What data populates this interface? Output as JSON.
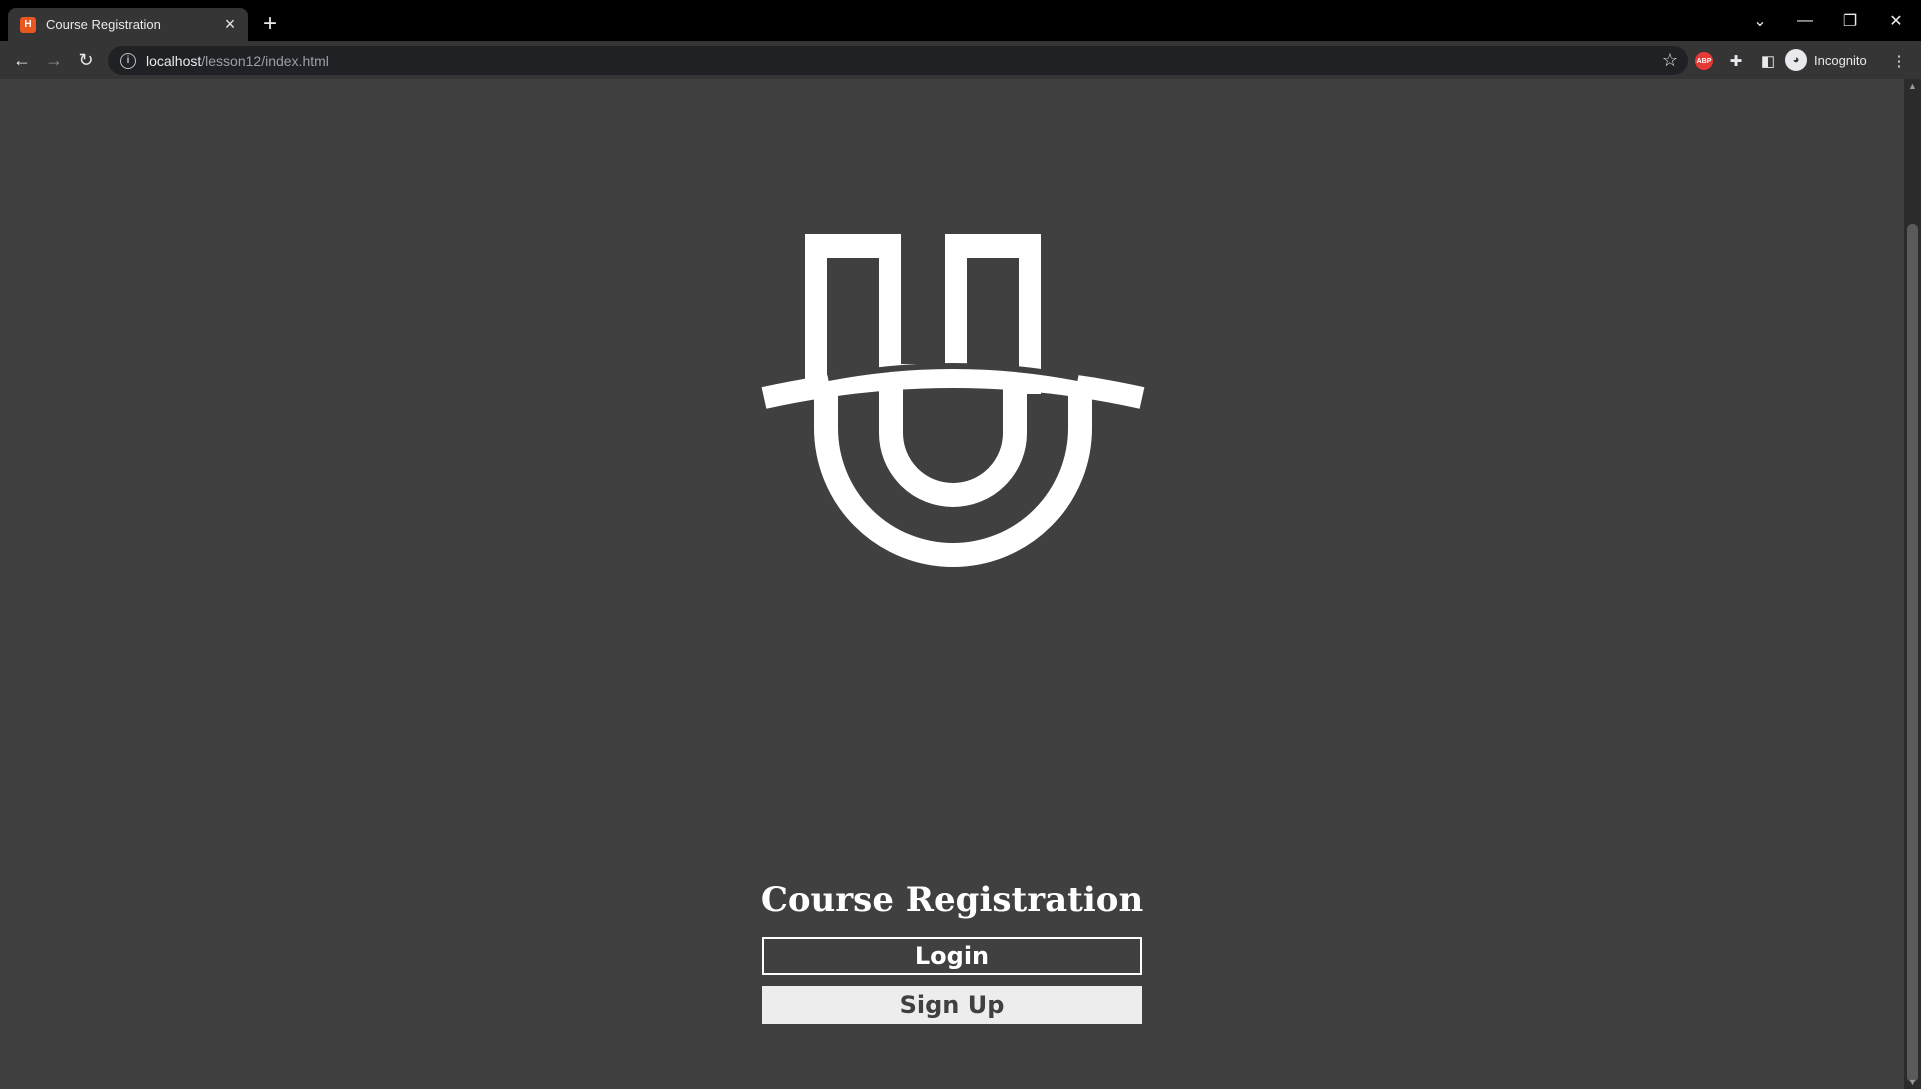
{
  "browser": {
    "tab_title": "Course Registration",
    "favicon_text": "H",
    "new_tab": "+",
    "url_host": "localhost",
    "url_path": "/lesson12/index.html",
    "incognito_label": "Incognito",
    "extension_abp": "ABP"
  },
  "page": {
    "title": "Course Registration",
    "login_label": "Login",
    "signup_label": "Sign Up"
  },
  "colors": {
    "page_bg": "#404040",
    "accent": "#ffffff",
    "signup_bg": "#ededed"
  }
}
